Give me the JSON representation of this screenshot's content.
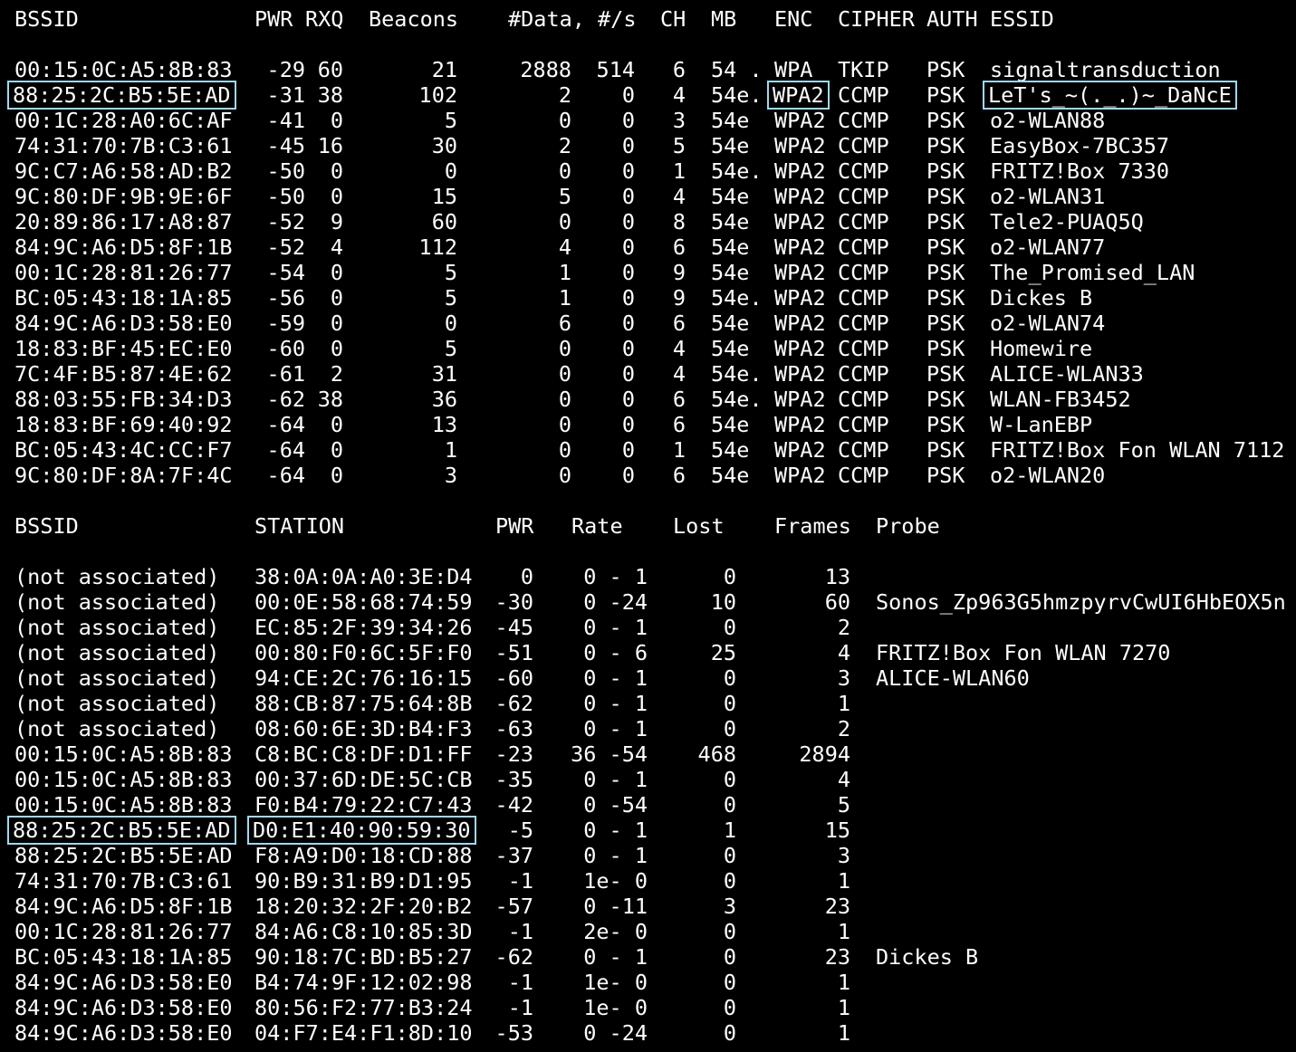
{
  "colors": {
    "background": "#000000",
    "text": "#ffffff",
    "highlight_box": "#9fd9f2"
  },
  "ap_header": {
    "bssid": "BSSID",
    "pwr": "PWR",
    "rxq": "RXQ",
    "beacons": "Beacons",
    "data": "#Data, #/s",
    "ch": "CH",
    "mb": "MB",
    "enc": "ENC",
    "cipher": "CIPHER",
    "auth": "AUTH",
    "essid": "ESSID"
  },
  "access_points": [
    {
      "bssid": "00:15:0C:A5:8B:83",
      "pwr": "-29",
      "rxq": "60",
      "beacons": "21",
      "data": "2888",
      "rate": "514",
      "ch": "6",
      "mb": "54 .",
      "enc": "WPA",
      "cipher": "TKIP",
      "auth": "PSK",
      "essid": "signaltransduction"
    },
    {
      "bssid": "88:25:2C:B5:5E:AD",
      "pwr": "-31",
      "rxq": "38",
      "beacons": "102",
      "data": "2",
      "rate": "0",
      "ch": "4",
      "mb": "54e.",
      "enc": "WPA2",
      "cipher": "CCMP",
      "auth": "PSK",
      "essid": "LeT's_~(._.)~_DaNcE",
      "highlighted": true
    },
    {
      "bssid": "00:1C:28:A0:6C:AF",
      "pwr": "-41",
      "rxq": "0",
      "beacons": "5",
      "data": "0",
      "rate": "0",
      "ch": "3",
      "mb": "54e",
      "enc": "WPA2",
      "cipher": "CCMP",
      "auth": "PSK",
      "essid": "o2-WLAN88"
    },
    {
      "bssid": "74:31:70:7B:C3:61",
      "pwr": "-45",
      "rxq": "16",
      "beacons": "30",
      "data": "2",
      "rate": "0",
      "ch": "5",
      "mb": "54e",
      "enc": "WPA2",
      "cipher": "CCMP",
      "auth": "PSK",
      "essid": "EasyBox-7BC357"
    },
    {
      "bssid": "9C:C7:A6:58:AD:B2",
      "pwr": "-50",
      "rxq": "0",
      "beacons": "0",
      "data": "0",
      "rate": "0",
      "ch": "1",
      "mb": "54e.",
      "enc": "WPA2",
      "cipher": "CCMP",
      "auth": "PSK",
      "essid": "FRITZ!Box 7330"
    },
    {
      "bssid": "9C:80:DF:9B:9E:6F",
      "pwr": "-50",
      "rxq": "0",
      "beacons": "15",
      "data": "5",
      "rate": "0",
      "ch": "4",
      "mb": "54e",
      "enc": "WPA2",
      "cipher": "CCMP",
      "auth": "PSK",
      "essid": "o2-WLAN31"
    },
    {
      "bssid": "20:89:86:17:A8:87",
      "pwr": "-52",
      "rxq": "9",
      "beacons": "60",
      "data": "0",
      "rate": "0",
      "ch": "8",
      "mb": "54e",
      "enc": "WPA2",
      "cipher": "CCMP",
      "auth": "PSK",
      "essid": "Tele2-PUAQ5Q"
    },
    {
      "bssid": "84:9C:A6:D5:8F:1B",
      "pwr": "-52",
      "rxq": "4",
      "beacons": "112",
      "data": "4",
      "rate": "0",
      "ch": "6",
      "mb": "54e",
      "enc": "WPA2",
      "cipher": "CCMP",
      "auth": "PSK",
      "essid": "o2-WLAN77"
    },
    {
      "bssid": "00:1C:28:81:26:77",
      "pwr": "-54",
      "rxq": "0",
      "beacons": "5",
      "data": "1",
      "rate": "0",
      "ch": "9",
      "mb": "54e",
      "enc": "WPA2",
      "cipher": "CCMP",
      "auth": "PSK",
      "essid": "The_Promised_LAN"
    },
    {
      "bssid": "BC:05:43:18:1A:85",
      "pwr": "-56",
      "rxq": "0",
      "beacons": "5",
      "data": "1",
      "rate": "0",
      "ch": "9",
      "mb": "54e.",
      "enc": "WPA2",
      "cipher": "CCMP",
      "auth": "PSK",
      "essid": "Dickes B"
    },
    {
      "bssid": "84:9C:A6:D3:58:E0",
      "pwr": "-59",
      "rxq": "0",
      "beacons": "0",
      "data": "6",
      "rate": "0",
      "ch": "6",
      "mb": "54e",
      "enc": "WPA2",
      "cipher": "CCMP",
      "auth": "PSK",
      "essid": "o2-WLAN74"
    },
    {
      "bssid": "18:83:BF:45:EC:E0",
      "pwr": "-60",
      "rxq": "0",
      "beacons": "5",
      "data": "0",
      "rate": "0",
      "ch": "4",
      "mb": "54e",
      "enc": "WPA2",
      "cipher": "CCMP",
      "auth": "PSK",
      "essid": "Homewire"
    },
    {
      "bssid": "7C:4F:B5:87:4E:62",
      "pwr": "-61",
      "rxq": "2",
      "beacons": "31",
      "data": "0",
      "rate": "0",
      "ch": "4",
      "mb": "54e.",
      "enc": "WPA2",
      "cipher": "CCMP",
      "auth": "PSK",
      "essid": "ALICE-WLAN33"
    },
    {
      "bssid": "88:03:55:FB:34:D3",
      "pwr": "-62",
      "rxq": "38",
      "beacons": "36",
      "data": "0",
      "rate": "0",
      "ch": "6",
      "mb": "54e.",
      "enc": "WPA2",
      "cipher": "CCMP",
      "auth": "PSK",
      "essid": "WLAN-FB3452"
    },
    {
      "bssid": "18:83:BF:69:40:92",
      "pwr": "-64",
      "rxq": "0",
      "beacons": "13",
      "data": "0",
      "rate": "0",
      "ch": "6",
      "mb": "54e",
      "enc": "WPA2",
      "cipher": "CCMP",
      "auth": "PSK",
      "essid": "W-LanEBP"
    },
    {
      "bssid": "BC:05:43:4C:CC:F7",
      "pwr": "-64",
      "rxq": "0",
      "beacons": "1",
      "data": "0",
      "rate": "0",
      "ch": "1",
      "mb": "54e",
      "enc": "WPA2",
      "cipher": "CCMP",
      "auth": "PSK",
      "essid": "FRITZ!Box Fon WLAN 7112"
    },
    {
      "bssid": "9C:80:DF:8A:7F:4C",
      "pwr": "-64",
      "rxq": "0",
      "beacons": "3",
      "data": "0",
      "rate": "0",
      "ch": "6",
      "mb": "54e",
      "enc": "WPA2",
      "cipher": "CCMP",
      "auth": "PSK",
      "essid": "o2-WLAN20"
    }
  ],
  "station_header": {
    "bssid": "BSSID",
    "station": "STATION",
    "pwr": "PWR",
    "rate": "Rate",
    "lost": "Lost",
    "frames": "Frames",
    "probe": "Probe"
  },
  "stations": [
    {
      "bssid": "(not associated)",
      "station": "38:0A:0A:A0:3E:D4",
      "pwr": "0",
      "rate": "0 - 1",
      "lost": "0",
      "frames": "13",
      "probe": ""
    },
    {
      "bssid": "(not associated)",
      "station": "00:0E:58:68:74:59",
      "pwr": "-30",
      "rate": "0 -24",
      "lost": "10",
      "frames": "60",
      "probe": "Sonos_Zp963G5hmzpyrvCwUI6HbEOX5n"
    },
    {
      "bssid": "(not associated)",
      "station": "EC:85:2F:39:34:26",
      "pwr": "-45",
      "rate": "0 - 1",
      "lost": "0",
      "frames": "2",
      "probe": ""
    },
    {
      "bssid": "(not associated)",
      "station": "00:80:F0:6C:5F:F0",
      "pwr": "-51",
      "rate": "0 - 6",
      "lost": "25",
      "frames": "4",
      "probe": "FRITZ!Box Fon WLAN 7270"
    },
    {
      "bssid": "(not associated)",
      "station": "94:CE:2C:76:16:15",
      "pwr": "-60",
      "rate": "0 - 1",
      "lost": "0",
      "frames": "3",
      "probe": "ALICE-WLAN60"
    },
    {
      "bssid": "(not associated)",
      "station": "88:CB:87:75:64:8B",
      "pwr": "-62",
      "rate": "0 - 1",
      "lost": "0",
      "frames": "1",
      "probe": ""
    },
    {
      "bssid": "(not associated)",
      "station": "08:60:6E:3D:B4:F3",
      "pwr": "-63",
      "rate": "0 - 1",
      "lost": "0",
      "frames": "2",
      "probe": ""
    },
    {
      "bssid": "00:15:0C:A5:8B:83",
      "station": "C8:BC:C8:DF:D1:FF",
      "pwr": "-23",
      "rate": "36 -54",
      "lost": "468",
      "frames": "2894",
      "probe": ""
    },
    {
      "bssid": "00:15:0C:A5:8B:83",
      "station": "00:37:6D:DE:5C:CB",
      "pwr": "-35",
      "rate": "0 - 1",
      "lost": "0",
      "frames": "4",
      "probe": ""
    },
    {
      "bssid": "00:15:0C:A5:8B:83",
      "station": "F0:B4:79:22:C7:43",
      "pwr": "-42",
      "rate": "0 -54",
      "lost": "0",
      "frames": "5",
      "probe": ""
    },
    {
      "bssid": "88:25:2C:B5:5E:AD",
      "station": "D0:E1:40:90:59:30",
      "pwr": "-5",
      "rate": "0 - 1",
      "lost": "1",
      "frames": "15",
      "probe": "",
      "highlighted": true
    },
    {
      "bssid": "88:25:2C:B5:5E:AD",
      "station": "F8:A9:D0:18:CD:88",
      "pwr": "-37",
      "rate": "0 - 1",
      "lost": "0",
      "frames": "3",
      "probe": ""
    },
    {
      "bssid": "74:31:70:7B:C3:61",
      "station": "90:B9:31:B9:D1:95",
      "pwr": "-1",
      "rate": "1e- 0",
      "lost": "0",
      "frames": "1",
      "probe": ""
    },
    {
      "bssid": "84:9C:A6:D5:8F:1B",
      "station": "18:20:32:2F:20:B2",
      "pwr": "-57",
      "rate": "0 -11",
      "lost": "3",
      "frames": "23",
      "probe": ""
    },
    {
      "bssid": "00:1C:28:81:26:77",
      "station": "84:A6:C8:10:85:3D",
      "pwr": "-1",
      "rate": "2e- 0",
      "lost": "0",
      "frames": "1",
      "probe": ""
    },
    {
      "bssid": "BC:05:43:18:1A:85",
      "station": "90:18:7C:BD:B5:27",
      "pwr": "-62",
      "rate": "0 - 1",
      "lost": "0",
      "frames": "23",
      "probe": "Dickes B"
    },
    {
      "bssid": "84:9C:A6:D3:58:E0",
      "station": "B4:74:9F:12:02:98",
      "pwr": "-1",
      "rate": "1e- 0",
      "lost": "0",
      "frames": "1",
      "probe": ""
    },
    {
      "bssid": "84:9C:A6:D3:58:E0",
      "station": "80:56:F2:77:B3:24",
      "pwr": "-1",
      "rate": "1e- 0",
      "lost": "0",
      "frames": "1",
      "probe": ""
    },
    {
      "bssid": "84:9C:A6:D3:58:E0",
      "station": "04:F7:E4:F1:8D:10",
      "pwr": "-53",
      "rate": "0 -24",
      "lost": "0",
      "frames": "1",
      "probe": ""
    }
  ]
}
